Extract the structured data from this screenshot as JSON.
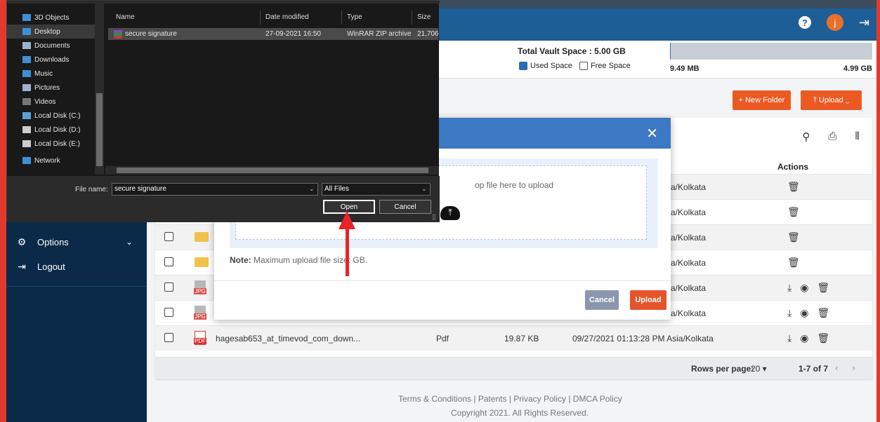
{
  "colors": {
    "frame": "#e03a2f",
    "topbar": "#1e5e97",
    "sidebar": "#0b2a4a",
    "accent": "#ec5a24",
    "modal_header": "#3c78c3",
    "used_space": "#2b6cb0"
  },
  "header": {
    "help_icon": "?",
    "avatar_letter": "j",
    "logout_icon": "⇥"
  },
  "sidebar": {
    "items": [
      {
        "label": "Options",
        "icon": "gear-icon",
        "glyph": "⚙",
        "chevron": "⌄"
      },
      {
        "label": "Logout",
        "icon": "logout-icon",
        "glyph": "⇥"
      }
    ]
  },
  "vault": {
    "title": "Total Vault Space : 5.00 GB",
    "used_label": "Used Space",
    "free_label": "Free Space",
    "used_value": "9.49 MB",
    "free_value": "4.99 GB",
    "used_fraction": 0.002
  },
  "toolbar": {
    "new_folder": "+ New Folder",
    "upload": "⤒ Upload ⌄"
  },
  "table": {
    "actions_header": "Actions",
    "tool_icons": [
      "⚲",
      "⎙",
      "⦀"
    ],
    "rows": [
      {
        "kind": "hidden",
        "name": "",
        "type": "",
        "size": "",
        "date": "a/Kolkata",
        "actions": [
          "🗑"
        ]
      },
      {
        "kind": "hidden",
        "name": "",
        "type": "",
        "size": "",
        "date": "a/Kolkata",
        "actions": [
          "🗑"
        ]
      },
      {
        "kind": "folder",
        "name": "",
        "type": "",
        "size": "",
        "date": "a/Kolkata",
        "actions": [
          "🗑"
        ]
      },
      {
        "kind": "folder",
        "name": "",
        "type": "",
        "size": "",
        "date": "a/Kolkata",
        "actions": [
          "🗑"
        ]
      },
      {
        "kind": "jpg",
        "name": "",
        "type": "",
        "size": "",
        "date": "a/Kolkata",
        "actions": [
          "⤓",
          "◉",
          "🗑"
        ]
      },
      {
        "kind": "jpg",
        "name": "",
        "type": "",
        "size": "",
        "date": "a/Kolkata",
        "actions": [
          "⤓",
          "◉",
          "🗑"
        ]
      },
      {
        "kind": "pdf",
        "name": "hagesab653_at_timevod_com_down...",
        "type": "Pdf",
        "size": "19.87 KB",
        "date": "09/27/2021 01:13:28 PM Asia/Kolkata",
        "actions": [
          "⤓",
          "◉",
          "🗑"
        ]
      }
    ],
    "jpg_label": "JPG",
    "pdf_label": "PDF"
  },
  "pager": {
    "rows_per_page_label": "Rows per page:",
    "rows_per_page_value": "20 ▾",
    "range": "1-7 of 7",
    "prev": "‹",
    "next": "›"
  },
  "footer": {
    "links": "Terms & Conditions  |  Patents  |  Privacy Policy  |  DMCA Policy",
    "copyright": "Copyright 2021. All Rights Reserved."
  },
  "upload_modal": {
    "close": "✕",
    "drop_text": "op file here to upload",
    "note_label": "Note:",
    "note_text": " Maximum upload file size:   GB.",
    "cloud_icon": "⤒",
    "cancel": "Cancel",
    "upload": "Upload"
  },
  "file_dialog": {
    "nav_items": [
      "3D Objects",
      "Desktop",
      "Documents",
      "Downloads",
      "Music",
      "Pictures",
      "Videos",
      "Local Disk (C:)",
      "Local Disk (D:)",
      "Local Disk (E:)",
      "Network"
    ],
    "selected_nav": "Desktop",
    "columns": [
      "Name",
      "Date modified",
      "Type",
      "Size"
    ],
    "file": {
      "name": "secure signature",
      "date": "27-09-2021 16:50",
      "type": "WinRAR ZIP archive",
      "size": "21,706"
    },
    "file_name_label": "File name:",
    "file_name_value": "secure signature",
    "file_type": "All Files",
    "open": "Open",
    "cancel": "Cancel"
  }
}
